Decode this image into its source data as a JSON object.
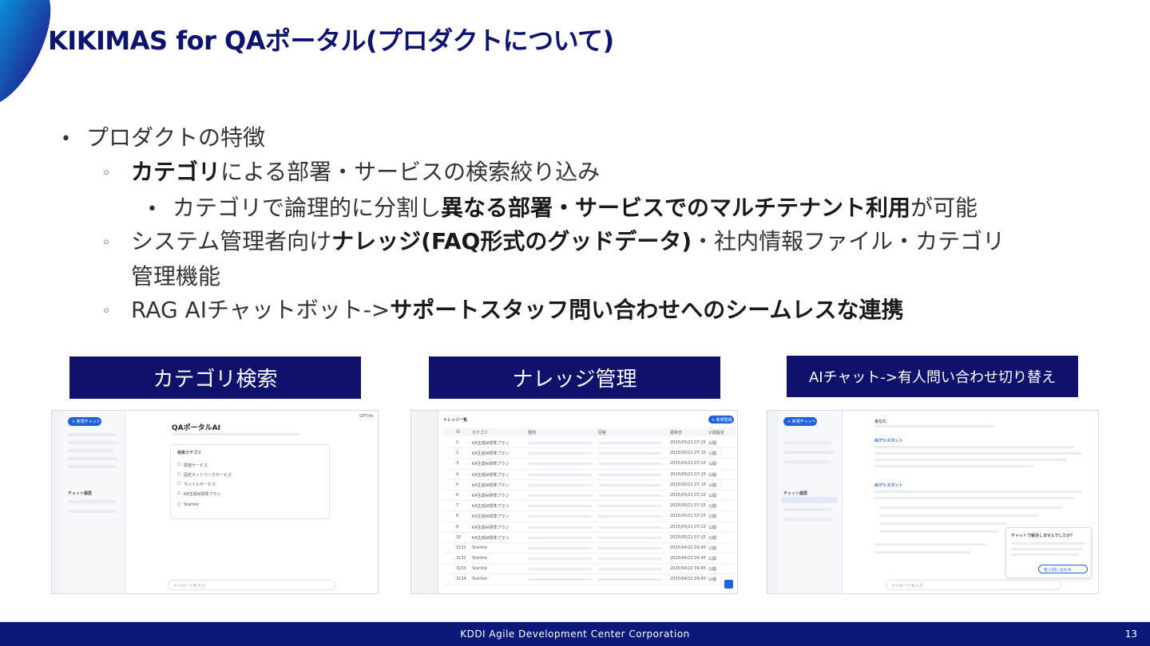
{
  "title": "KIKIMAS for QAポータル(プロダクトについて)",
  "bullets": {
    "b1": "プロダクトの特徴",
    "b2": {
      "bold": "カテゴリ",
      "rest": "による部署・サービスの検索絞り込み"
    },
    "b3": {
      "pre": "カテゴリで論理的に分割し",
      "bold": "異なる部署・サービスでのマルチテナント利用",
      "post": "が可能"
    },
    "b4": {
      "pre": "システム管理者向け",
      "bold": "ナレッジ(FAQ形式のグッドデータ)",
      "post": "・社内情報ファイル・カテゴリ",
      "line2": "管理機能"
    },
    "b5": {
      "pre": "RAG AIチャットボット->",
      "bold": "サポートスタッフ問い合わせへのシームレスな連携"
    }
  },
  "labels": {
    "category_search": "カテゴリ検索",
    "knowledge_mgmt": "ナレッジ管理",
    "ai_chat_switch": "AIチャット->有人問い合わせ切り替え"
  },
  "shot1": {
    "new_chat": "+ 新規チャット",
    "app_title": "QAポータルAI",
    "model": "GPT-4o",
    "checkbox_header": "検索カテゴリ",
    "options": [
      "関連サービス",
      "固定ネットワークサービス",
      "モバイルサービス",
      "KA生成AI標準プラン",
      "Starlink"
    ],
    "history_header": "チャット履歴",
    "input_placeholder": "メッセージを入力"
  },
  "shot2": {
    "list_title": "ナレッジ一覧",
    "new_button": "+ 新規登録",
    "columns": [
      "ID",
      "カテゴリ",
      "質問",
      "回答",
      "更新日",
      "公開設定"
    ],
    "rows": [
      {
        "id": "1",
        "cat": "KA生成AI標準プラン",
        "date": "2025/05/21 07:15",
        "status": "公開"
      },
      {
        "id": "2",
        "cat": "KA生成AI標準プラン",
        "date": "2025/05/21 07:15",
        "status": "公開"
      },
      {
        "id": "3",
        "cat": "KA生成AI標準プラン",
        "date": "2025/05/21 07:15",
        "status": "公開"
      },
      {
        "id": "4",
        "cat": "KA生成AI標準プラン",
        "date": "2025/05/21 07:15",
        "status": "公開"
      },
      {
        "id": "5",
        "cat": "KA生成AI標準プラン",
        "date": "2025/05/21 07:15",
        "status": "公開"
      },
      {
        "id": "6",
        "cat": "KA生成AI標準プラン",
        "date": "2025/05/21 07:15",
        "status": "公開"
      },
      {
        "id": "7",
        "cat": "KA生成AI標準プラン",
        "date": "2025/05/21 07:15",
        "status": "公開"
      },
      {
        "id": "8",
        "cat": "KA生成AI標準プラン",
        "date": "2025/05/21 07:15",
        "status": "公開"
      },
      {
        "id": "9",
        "cat": "KA生成AI標準プラン",
        "date": "2025/05/21 07:15",
        "status": "公開"
      },
      {
        "id": "10",
        "cat": "KA生成AI標準プラン",
        "date": "2025/05/21 07:15",
        "status": "公開"
      },
      {
        "id": "3131",
        "cat": "Starlink",
        "date": "2025/04/22 09:45",
        "status": "公開"
      },
      {
        "id": "3132",
        "cat": "Starlink",
        "date": "2025/04/22 09:45",
        "status": "公開"
      },
      {
        "id": "3133",
        "cat": "Starlink",
        "date": "2025/04/22 09:45",
        "status": "公開"
      },
      {
        "id": "3134",
        "cat": "Starlink",
        "date": "2025/04/22 09:45",
        "status": "公開"
      }
    ]
  },
  "shot3": {
    "new_chat": "+ 新規チャット",
    "user": "あなた",
    "assistant": "AIアシスタント",
    "popup_title": "チャットで解決しませんでしたか？",
    "human_button": "有人問い合わせ",
    "history_header": "チャット履歴",
    "input_placeholder": "メッセージを入力"
  },
  "footer": {
    "company": "KDDI Agile Development Center Corporation",
    "page": "13"
  }
}
